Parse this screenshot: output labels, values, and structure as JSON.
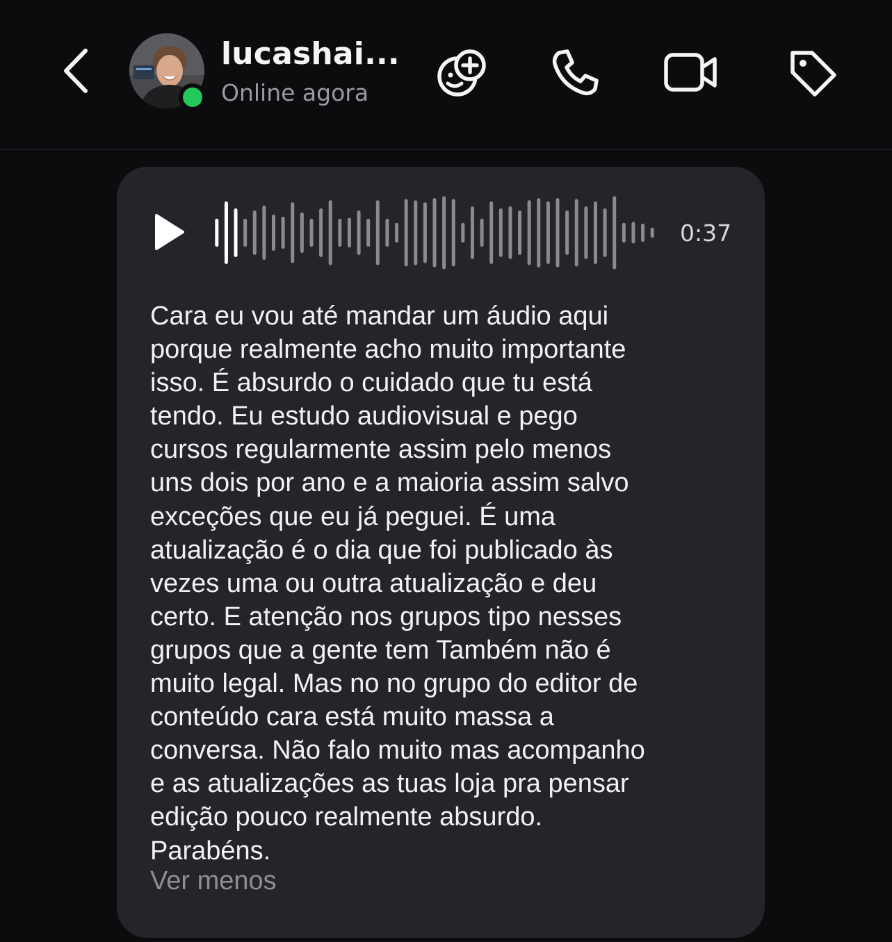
{
  "header": {
    "contact_name": "lucashai...",
    "status": "Online agora",
    "icons": {
      "back": "chevron-left-icon",
      "stickers": "sticker-add-icon",
      "call": "phone-icon",
      "video": "video-camera-icon",
      "tag": "tag-icon"
    },
    "online_color": "#24c85a"
  },
  "message": {
    "type": "voice-transcript",
    "duration": "0:37",
    "playback_progress": 0.06,
    "transcript": "Cara eu vou até mandar um áudio aqui\nporque realmente acho muito importante\nisso. É absurdo o cuidado que tu está\ntendo. Eu estudo audiovisual e pego\ncursos regularmente assim pelo menos\nuns dois por ano e a maioria assim salvo\nexceções que eu já peguei. É uma\natualização é o dia que foi publicado às\nvezes uma ou outra atualização e deu\ncerto. E atenção nos grupos tipo nesses\ngrupos que a gente tem Também não é\nmuito legal. Mas no no grupo do editor de\nconteúdo cara está muito massa a\nconversa. Não falo muito mas acompanho\ne as atualizações as tuas loja pra pensar\nedição pouco realmente absurdo.\nParabéns.",
    "toggle_label": "Ver menos"
  },
  "colors": {
    "background": "#0c0c0e",
    "bubble": "#242529",
    "waveform_played": "#ffffff",
    "waveform_unplayed": "#8a8a90"
  }
}
